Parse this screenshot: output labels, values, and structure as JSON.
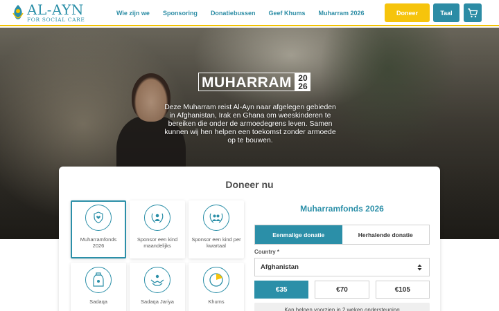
{
  "header": {
    "logo": {
      "main": "AL-AYN",
      "sub": "FOR SOCIAL CARE"
    },
    "nav": [
      "Wie zijn we",
      "Sponsoring",
      "Donatiebussen",
      "Geef Khums",
      "Muharram 2026"
    ],
    "donate_label": "Doneer",
    "language_label": "Taal",
    "cart_icon": "cart-icon"
  },
  "hero": {
    "title": "MUHARRAM",
    "year_top": "20",
    "year_bottom": "26",
    "text": "Deze Muharram reist Al-Ayn naar afgelegen gebieden in Afghanistan, Irak en Ghana om weeskinderen te bereiken die onder de armoedegrens leven. Samen kunnen wij hen helpen een toekomst zonder armoede op te bouwen."
  },
  "donation": {
    "title": "Doneer nu",
    "funds": [
      {
        "label": "Muharramfonds 2026",
        "icon": "hand-heart-shield-icon",
        "selected": true
      },
      {
        "label": "Sponsor een kind maandelijks",
        "icon": "child-laurel-icon",
        "selected": false
      },
      {
        "label": "Sponsor een kind per kwartaal",
        "icon": "children-laurel-icon",
        "selected": false
      },
      {
        "label": "Sadaqa",
        "icon": "charity-jar-icon",
        "selected": false
      },
      {
        "label": "Sadaqa Jariya",
        "icon": "hands-giving-icon",
        "selected": false
      },
      {
        "label": "Khums",
        "icon": "khums-circle-icon",
        "selected": false
      }
    ],
    "selected_fund": "Muharramfonds 2026",
    "frequency": {
      "one_time": "Eenmalige donatie",
      "recurring": "Herhalende donatie",
      "selected": "Eenmalige donatie"
    },
    "country_label": "Country *",
    "country_value": "Afghanistan",
    "amounts": [
      "€35",
      "€70",
      "€105"
    ],
    "selected_amount": "€35",
    "impact_text": "Kan helpen voorzien in 2 weken ondersteuning"
  },
  "colors": {
    "brand": "#2b8fa8",
    "accent": "#f6c40c",
    "header_border": "#f2c200"
  }
}
